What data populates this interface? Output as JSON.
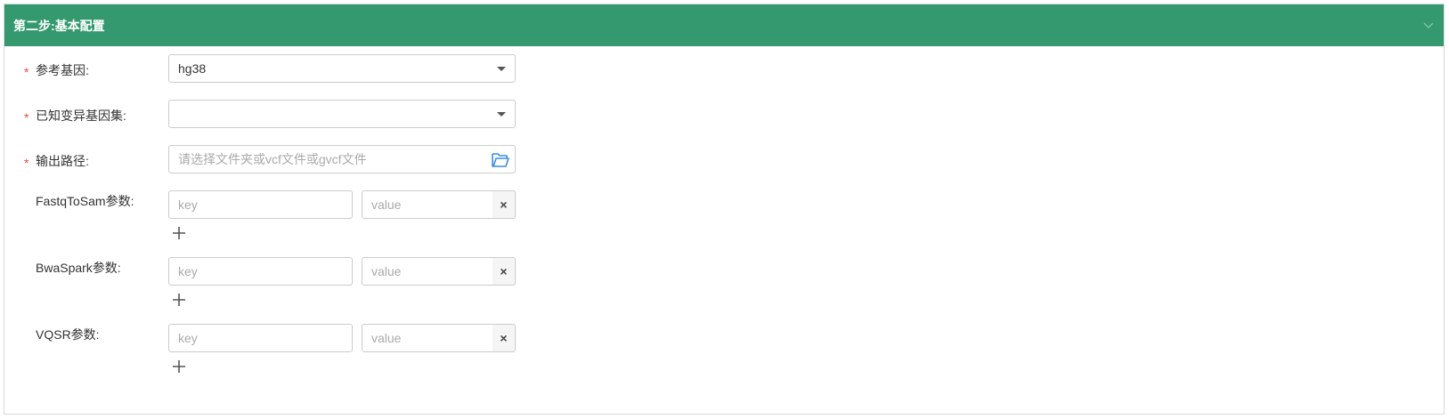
{
  "panel": {
    "title": "第二步:基本配置",
    "header_color": "#34996f"
  },
  "form": {
    "ref_genome": {
      "label": "参考基因:",
      "value": "hg38",
      "required": true
    },
    "known_variants": {
      "label": "已知变异基因集:",
      "value": "",
      "required": true
    },
    "output_path": {
      "label": "输出路径:",
      "placeholder": "请选择文件夹或vcf文件或gvcf文件",
      "required": true
    },
    "params": [
      {
        "label": "FastqToSam参数:",
        "key_placeholder": "key",
        "value_placeholder": "value"
      },
      {
        "label": "BwaSpark参数:",
        "key_placeholder": "key",
        "value_placeholder": "value"
      },
      {
        "label": "VQSR参数:",
        "key_placeholder": "key",
        "value_placeholder": "value"
      }
    ]
  },
  "icons": {
    "collapse": "chevron-down-icon",
    "dropdown": "caret-down-icon",
    "folder": "folder-open-icon",
    "clear": "close-icon",
    "add": "plus-icon"
  },
  "colors": {
    "required_star": "#e74c3c",
    "folder_icon": "#3a8ee6"
  },
  "symbols": {
    "required_star": "*",
    "clear": "×"
  }
}
